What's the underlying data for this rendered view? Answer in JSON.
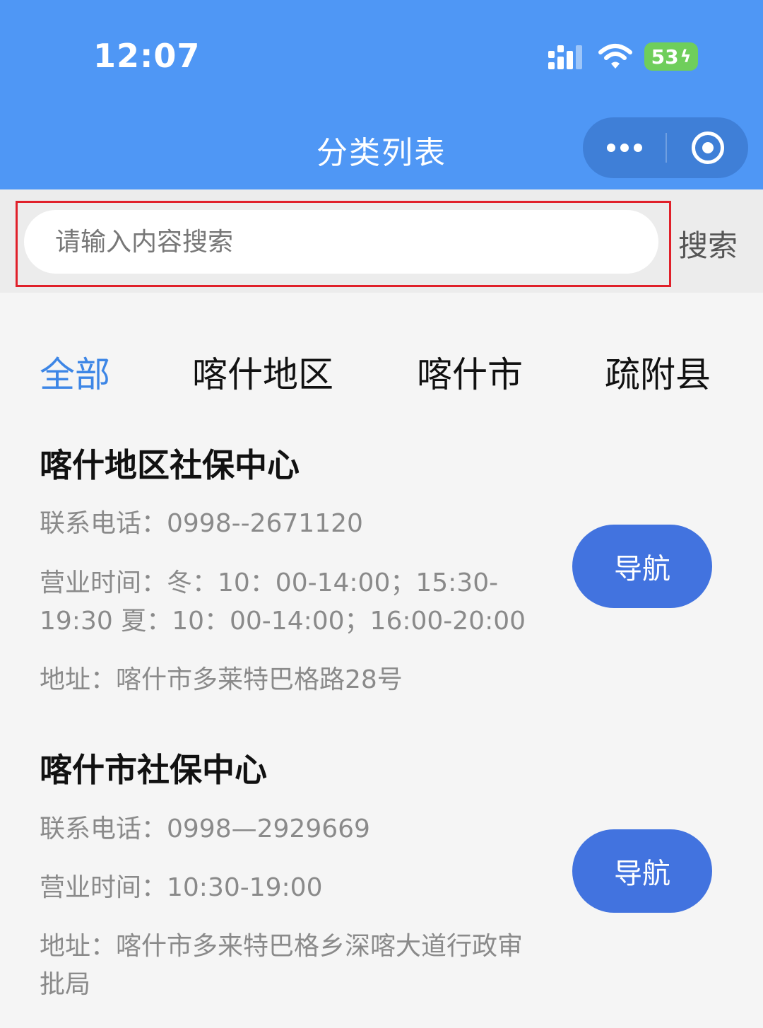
{
  "status_bar": {
    "time": "12:07",
    "battery": "53",
    "icons": [
      "signal-icon",
      "wifi-icon",
      "battery-icon",
      "bolt-icon"
    ]
  },
  "nav": {
    "title": "分类列表",
    "icons": [
      "more-icon",
      "close-icon"
    ]
  },
  "search": {
    "placeholder": "请输入内容搜索",
    "button_label": "搜索"
  },
  "tabs": [
    {
      "label": "全部",
      "active": true
    },
    {
      "label": "喀什地区",
      "active": false
    },
    {
      "label": "喀什市",
      "active": false
    },
    {
      "label": "疏附县",
      "active": false
    }
  ],
  "centers": [
    {
      "name": "喀什地区社保中心",
      "phone": "联系电话：0998--2671120",
      "hours_line1": "营业时间：冬：10：00-14:00；15:30-",
      "hours_line2": "19:30 夏：10：00-14:00；16:00-20:00",
      "address_line1": "地址：喀什市多莱特巴格路28号",
      "nav_label": "导航"
    },
    {
      "name": "喀什市社保中心",
      "phone": "联系电话：0998—2929669",
      "hours_line1": "营业时间：10:30-19:00",
      "address_line1": "地址：喀什市多来特巴格乡深喀大道行政审",
      "address_line2": "批局",
      "nav_label": "导航"
    }
  ],
  "colors": {
    "header": "#4f97f5",
    "accent": "#3d86e6",
    "nav_button": "#4273df",
    "highlight_border": "#e0202a",
    "battery": "#6fce5b"
  }
}
